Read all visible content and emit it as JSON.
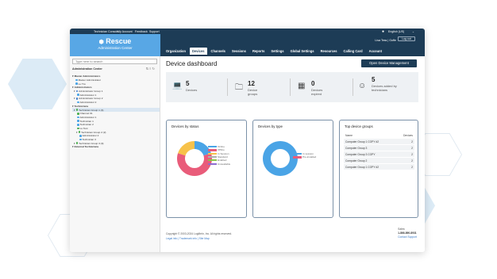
{
  "topbar": {
    "items": [
      "Technician Console",
      "My Account",
      "Feedback",
      "Support"
    ],
    "language": "English (US)"
  },
  "brand": {
    "title": "Rescue",
    "subtitle": "Administration Center"
  },
  "header": {
    "user": "Lisa Tess | Goffe",
    "logout": "Log out",
    "tabs": [
      "Organization",
      "Devices",
      "Channels",
      "Sessions",
      "Reports",
      "Settings",
      "Global Settings",
      "Resources",
      "Calling Card",
      "Account"
    ],
    "active_tab": "Devices"
  },
  "sidebar": {
    "search_placeholder": "Type here to search",
    "title": "Administration Center",
    "tree": [
      {
        "label": "Master Administrators",
        "indent": 0,
        "bold": true,
        "color": ""
      },
      {
        "label": "Master Administrator",
        "indent": 3,
        "color": "#4aa4e6"
      },
      {
        "label": "Lu Tzo",
        "indent": 3,
        "color": "#4aa4e6"
      },
      {
        "label": "Administrators",
        "indent": 0,
        "bold": true,
        "color": ""
      },
      {
        "label": "Administrator Group 1",
        "indent": 2,
        "color": "#3e7bcc"
      },
      {
        "label": "Administrator 1",
        "indent": 5,
        "color": "#4aa4e6"
      },
      {
        "label": "Administrator Group 2",
        "indent": 2,
        "color": "#3e7bcc"
      },
      {
        "label": "Administrator 2",
        "indent": 5,
        "color": "#4aa4e6"
      },
      {
        "label": "Technicians",
        "indent": 0,
        "bold": true,
        "color": ""
      },
      {
        "label": "Technician Group 1 (4)",
        "indent": 2,
        "color": "#4caf50",
        "selected": true
      },
      {
        "label": "Channel 01",
        "indent": 5,
        "color": "#4caf50"
      },
      {
        "label": "Administrator 1",
        "indent": 5,
        "color": "#4aa4e6"
      },
      {
        "label": "Technician 1",
        "indent": 5,
        "color": "#4aa4e6"
      },
      {
        "label": "Technician 2",
        "indent": 5,
        "color": "#4aa4e6"
      },
      {
        "label": "Lu Test",
        "indent": 5,
        "color": "#4caf50"
      },
      {
        "label": "Technician Group 2 (2)",
        "indent": 5,
        "color": "#4caf50"
      },
      {
        "label": "Administrator 2",
        "indent": 8,
        "color": "#4aa4e6"
      },
      {
        "label": "Technician 3",
        "indent": 8,
        "color": "#4aa4e6"
      },
      {
        "label": "Technician Group 3 (0)",
        "indent": 2,
        "color": "#4caf50"
      },
      {
        "label": "External Technicians",
        "indent": 0,
        "bold": true,
        "color": ""
      }
    ]
  },
  "main": {
    "title": "Device dashboard",
    "open_button": "Open Device Management"
  },
  "summary": [
    {
      "number": "5",
      "label": "Devices",
      "icon": "laptop-icon"
    },
    {
      "number": "12",
      "label": "Device groups",
      "icon": "folder-icon"
    },
    {
      "number": "0",
      "label": "Devices expired",
      "icon": "calendar-icon"
    },
    {
      "number": "5",
      "label": "Devices added by technicians",
      "icon": "technician-icon"
    }
  ],
  "status_card": {
    "title": "Devices by status",
    "legend": [
      "Online",
      "Offline",
      "In Session",
      "Standard",
      "Enabled",
      "Unavailable"
    ],
    "colors": [
      "#4aa4e6",
      "#e95c7a",
      "#f7c24a",
      "#b0b0b0",
      "#8bc34a",
      "#8e6ccf"
    ]
  },
  "chart_data": [
    {
      "type": "pie",
      "title": "Devices by status",
      "categories": [
        "Online",
        "Offline",
        "In Session",
        "Standard",
        "Enabled",
        "Unavailable"
      ],
      "values": [
        1,
        3,
        1,
        0,
        0,
        0
      ]
    },
    {
      "type": "pie",
      "title": "Devices by type",
      "categories": [
        "In session",
        "Pre-installed"
      ],
      "values": [
        5,
        0
      ]
    }
  ],
  "type_card": {
    "title": "Devices by type",
    "legend": [
      "In session",
      "Pre-installed"
    ],
    "colors": [
      "#4aa4e6",
      "#e95c7a"
    ]
  },
  "groups_card": {
    "title": "Top device groups",
    "col_name": "Name",
    "col_devices": "Devices",
    "rows": [
      {
        "name": "Computer Group 1 COPY #2",
        "devices": "2"
      },
      {
        "name": "Computer Group 3",
        "devices": "2"
      },
      {
        "name": "Computer Group 3 COPY",
        "devices": "2"
      },
      {
        "name": "Computer Group 2",
        "devices": "2"
      },
      {
        "name": "Computer Group 1 COPY #2",
        "devices": "2"
      }
    ]
  },
  "footer": {
    "copyright": "Copyright © 2003-2024 LogMeIn, Inc. All rights reserved.",
    "links": "Legal info | Trademark info | Site Map"
  },
  "sales": {
    "label": "Sales:",
    "phone": "1-866-890-8931",
    "contact": "Contact Support"
  }
}
